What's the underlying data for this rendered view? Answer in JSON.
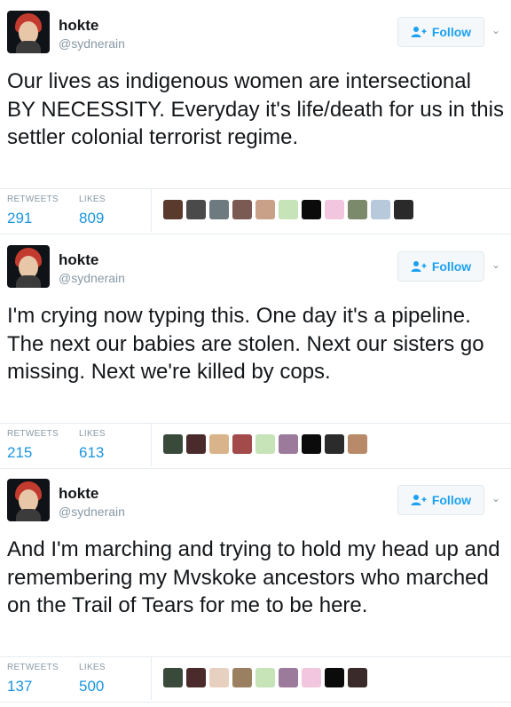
{
  "tweets": [
    {
      "name": "hokte",
      "handle": "@sydnerain",
      "follow_label": "Follow",
      "text": "Our lives as indigenous women are intersectional BY NECESSITY. Everyday it's life/death for us in this settler colonial terrorist regime.",
      "retweets_label": "RETWEETS",
      "retweets": "291",
      "likes_label": "LIKES",
      "likes": "809",
      "liker_colors": [
        "#5b3a2e",
        "#4a4a4a",
        "#6d7a80",
        "#7a5a52",
        "#c9a088",
        "#c7e3b8",
        "#0b0b0b",
        "#f2c6de",
        "#7b8a6a",
        "#b9c9dc",
        "#2a2a2a"
      ]
    },
    {
      "name": "hokte",
      "handle": "@sydnerain",
      "follow_label": "Follow",
      "text": "I'm crying now typing this. One day it's a pipeline. The next our babies are stolen. Next our sisters go missing. Next we're killed by cops.",
      "retweets_label": "RETWEETS",
      "retweets": "215",
      "likes_label": "LIKES",
      "likes": "613",
      "liker_colors": [
        "#3a4a3a",
        "#4a2a2a",
        "#d9b48a",
        "#a34a4a",
        "#c7e3b8",
        "#9c7a9c",
        "#0b0b0b",
        "#2b2b2b",
        "#b88a6a"
      ]
    },
    {
      "name": "hokte",
      "handle": "@sydnerain",
      "follow_label": "Follow",
      "text": "And I'm marching and trying to hold my head up and remembering my Mvskoke ancestors who marched on the Trail of Tears for me to be here.",
      "retweets_label": "RETWEETS",
      "retweets": "137",
      "likes_label": "LIKES",
      "likes": "500",
      "liker_colors": [
        "#3a4a3a",
        "#4a2a2a",
        "#e8d0c0",
        "#9a8060",
        "#c7e3b8",
        "#9c7a9c",
        "#f2c6de",
        "#0b0b0b",
        "#3a2a2a"
      ]
    }
  ]
}
